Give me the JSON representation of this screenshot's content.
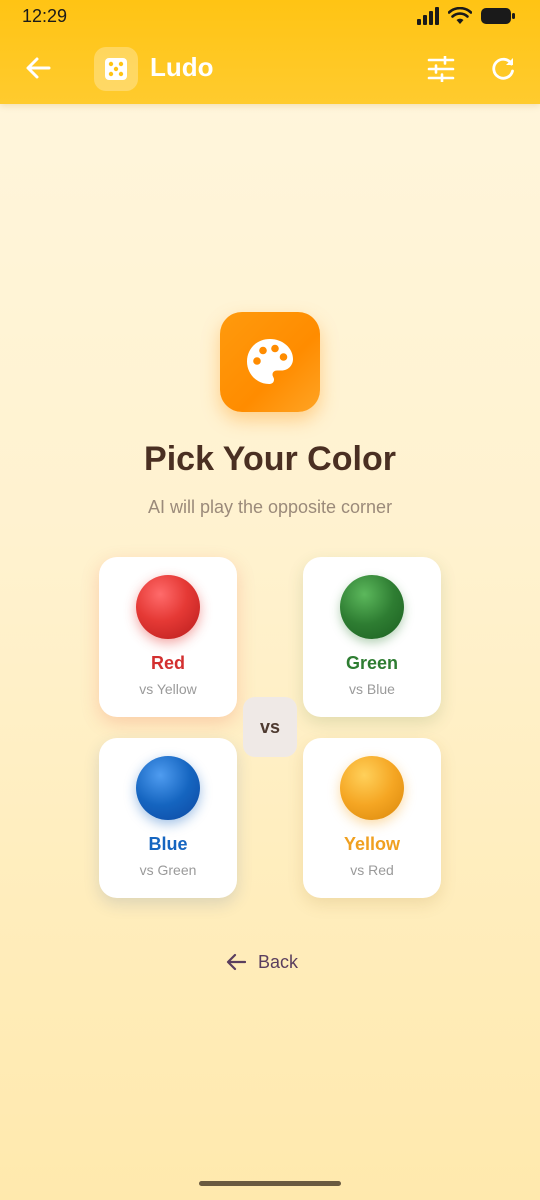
{
  "status_bar": {
    "time": "12:29"
  },
  "app_bar": {
    "title": "Ludo",
    "back_icon": "arrow-left-icon",
    "logo_icon": "dice-icon",
    "settings_icon": "tune-icon",
    "refresh_icon": "refresh-icon"
  },
  "hero": {
    "icon": "palette-icon"
  },
  "heading": "Pick Your Color",
  "subheading": "AI will play the opposite corner",
  "colors": [
    {
      "name": "Red",
      "opponent": "vs Yellow",
      "color": "#d32f2f"
    },
    {
      "name": "Green",
      "opponent": "vs Blue",
      "color": "#2e7d32"
    },
    {
      "name": "Blue",
      "opponent": "vs Green",
      "color": "#1565c0"
    },
    {
      "name": "Yellow",
      "opponent": "vs Red",
      "color": "#f0a020"
    }
  ],
  "vs_label": "vs",
  "back_button": {
    "label": "Back",
    "icon": "arrow-left-icon"
  },
  "theme": {
    "accent": "#ffc414",
    "hero": "#ff8c00"
  }
}
